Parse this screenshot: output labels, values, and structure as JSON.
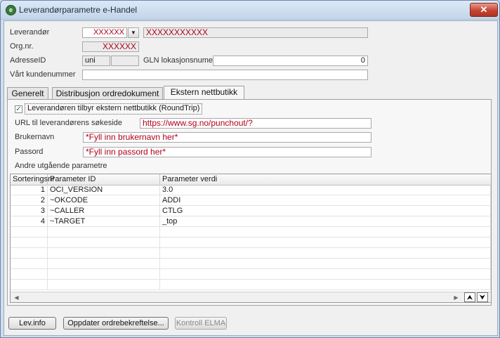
{
  "window": {
    "title": "Leverandørparametre e-Handel",
    "close_symbol": "✕",
    "app_icon_glyph": "e"
  },
  "header": {
    "supplier_label": "Leverandør",
    "supplier_code": "XXXXXX",
    "supplier_name": "XXXXXXXXXXX",
    "org_label": "Org.nr.",
    "org_value": "XXXXXX",
    "address_label": "AdresseID",
    "address_value": "uni",
    "gln_label": "GLN lokasjonsnumer",
    "gln_value": "0",
    "customer_label": "Vårt kundenummer",
    "customer_value": ""
  },
  "tabs": [
    {
      "label": "Generelt"
    },
    {
      "label": "Distribusjon ordredokument"
    },
    {
      "label": "Ekstern nettbutikk"
    }
  ],
  "panel": {
    "roundtrip_label": "Leverandøren tilbyr ekstern nettbutikk (RoundTrip)",
    "roundtrip_checked": true,
    "url_label": "URL til leverandørens søkeside",
    "url_value": "https://www.sg.no/punchout/?",
    "user_label": "Brukernavn",
    "user_value": "*Fyll inn brukernavn her*",
    "pass_label": "Passord",
    "pass_value": "*Fyll inn passord her*",
    "params_label": "Andre utgående parametre"
  },
  "grid": {
    "columns": [
      "Sorteringsnr",
      "Parameter ID",
      "Parameter verdi"
    ],
    "rows": [
      {
        "sort": "1",
        "id": "OCI_VERSION",
        "value": "3.0"
      },
      {
        "sort": "2",
        "id": " ~OKCODE",
        "value": "ADDI"
      },
      {
        "sort": "3",
        "id": "~CALLER",
        "value": "CTLG"
      },
      {
        "sort": "4",
        "id": "~TARGET",
        "value": "_top"
      }
    ]
  },
  "buttons": {
    "lev_info": "Lev.info",
    "update_confirm": "Oppdater ordrebekreftelse...",
    "check_elma": "Kontroll ELMA"
  },
  "colors": {
    "required_text": "#b0001a",
    "titlebar": "#c3d5ea",
    "close": "#c64534"
  }
}
